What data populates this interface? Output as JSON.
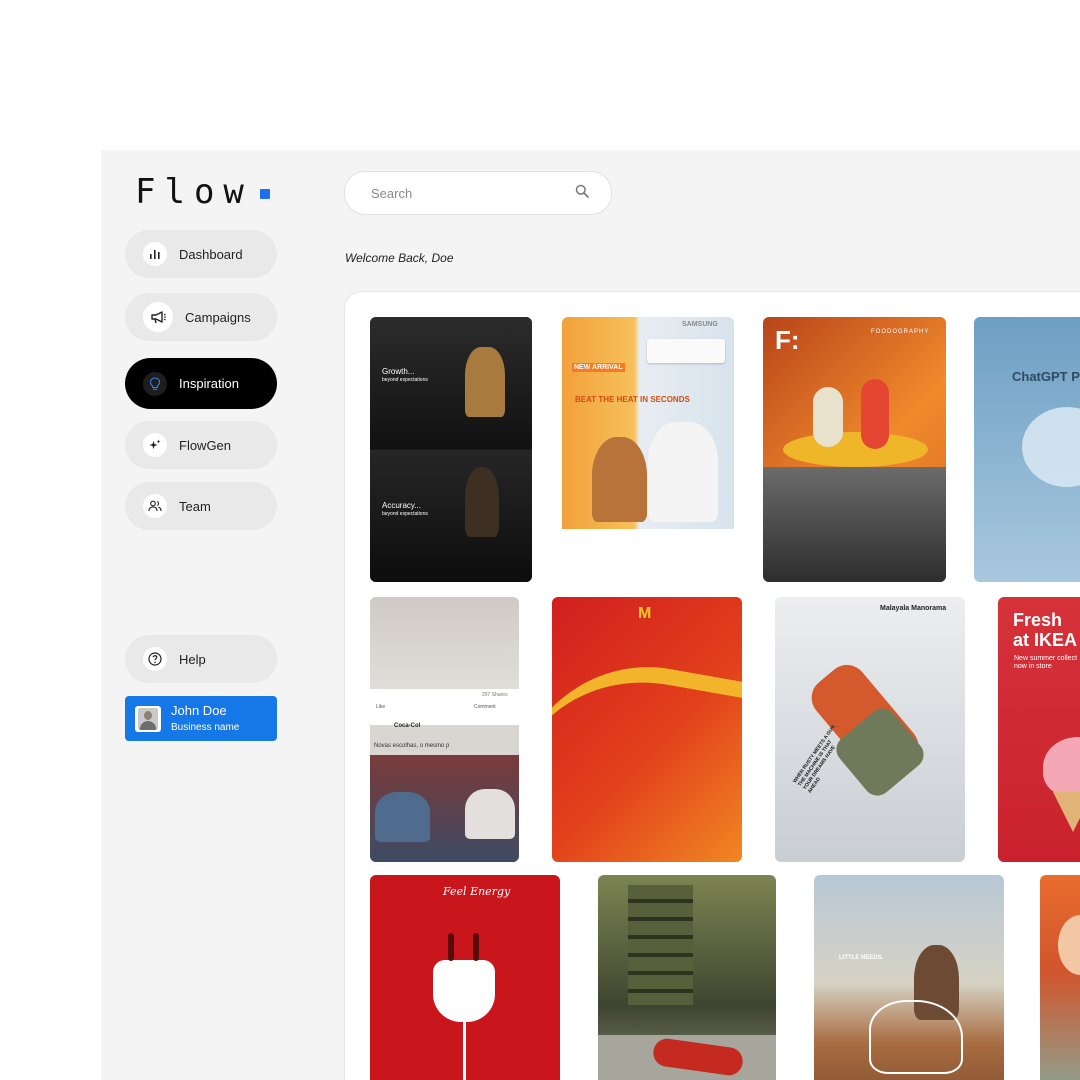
{
  "app": {
    "logo": "Flow",
    "brand_color": "#1f6feb"
  },
  "sidebar": {
    "items": [
      {
        "label": "Dashboard",
        "icon": "bar-chart-icon"
      },
      {
        "label": "Campaigns",
        "icon": "megaphone-icon"
      },
      {
        "label": "Inspiration",
        "icon": "lightbulb-icon",
        "active": true
      },
      {
        "label": "FlowGen",
        "icon": "sparkles-icon"
      },
      {
        "label": "Team",
        "icon": "users-icon"
      }
    ],
    "help": {
      "label": "Help",
      "icon": "help-circle-icon"
    },
    "profile": {
      "name": "John Doe",
      "business": "Business name",
      "color": "#1677e6"
    }
  },
  "header": {
    "search": {
      "placeholder": "Search",
      "icon": "search-icon"
    },
    "welcome": "Welcome Back, Doe"
  },
  "gallery": {
    "cards": [
      {
        "name": "growth-accuracy-ad",
        "texts": [
          "Growth...",
          "beyond expectations",
          "Accuracy...",
          "beyond expectations"
        ]
      },
      {
        "name": "samsung-ac-ad",
        "texts": [
          "SAMSUNG",
          "NEW ARRIVAL",
          "BEAT THE HEAT IN SECONDS"
        ]
      },
      {
        "name": "foodography-ad",
        "texts": [
          "F:",
          "FOODOGRAPHY"
        ]
      },
      {
        "name": "chatgpt-ad",
        "texts": [
          "ChatGPT Pr"
        ]
      },
      {
        "name": "coca-cola-social-ad",
        "texts": [
          "Coca-Col",
          "Novas escolhas, o mesmo p",
          "Like",
          "Comment",
          "297 Shares"
        ]
      },
      {
        "name": "mcdonalds-ad",
        "texts": [
          "M"
        ]
      },
      {
        "name": "malayala-manorama-ad",
        "texts": [
          "Malayala Manorama",
          "WHEN RUSTY MEETS A GUY, THE MACHINE IS THAT YOUR DREAMS HAVE AHEAD"
        ]
      },
      {
        "name": "ikea-ad",
        "texts": [
          "Fresh",
          "at IKEA",
          "New summer collect",
          "now in store"
        ]
      },
      {
        "name": "coca-cola-energy-ad",
        "texts": [
          "Feel Energy"
        ]
      },
      {
        "name": "spiderman-ad",
        "texts": []
      },
      {
        "name": "little-needs-ad",
        "texts": [
          "LITTLE NEEDS."
        ]
      },
      {
        "name": "portrait-ad",
        "texts": []
      }
    ]
  }
}
